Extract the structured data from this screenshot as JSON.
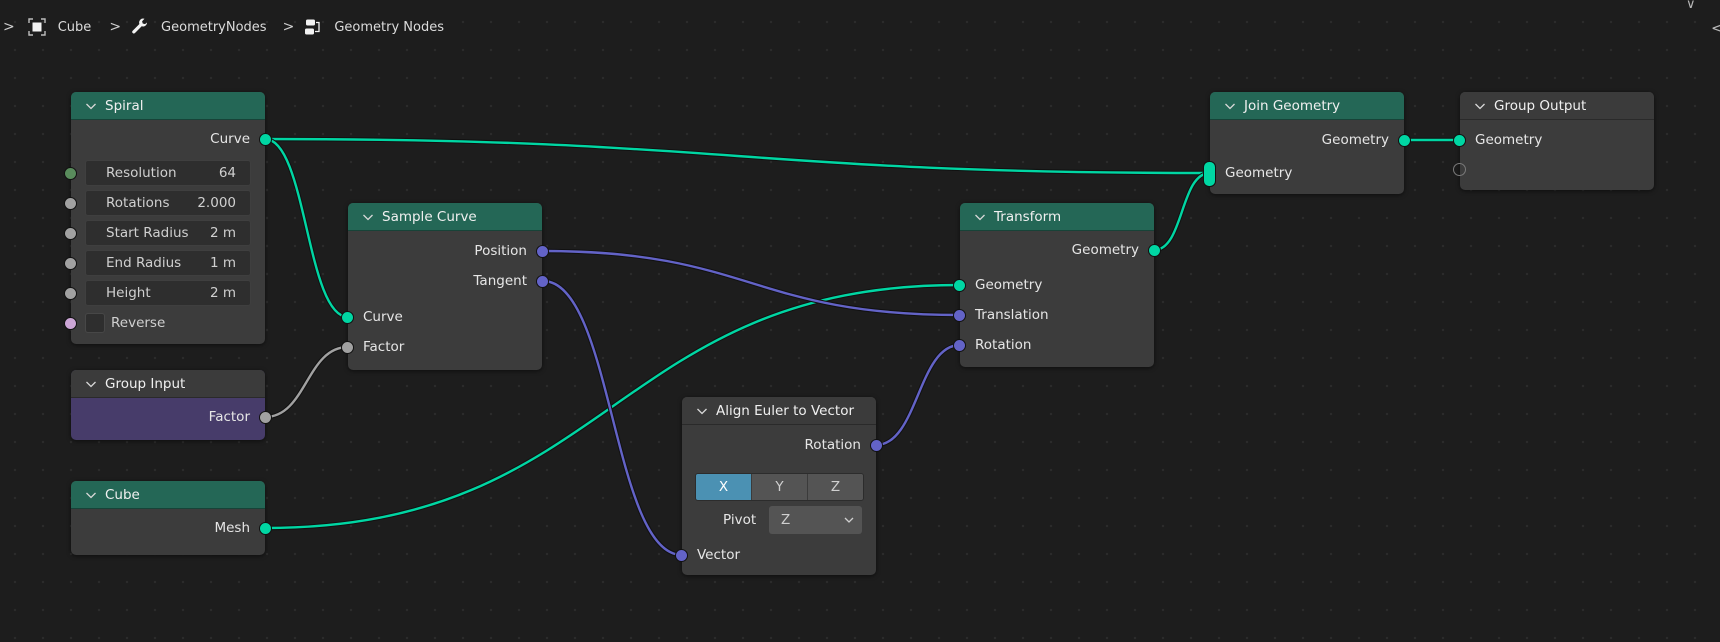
{
  "breadcrumb": {
    "items": [
      {
        "icon": "object-cube-icon",
        "label": "Cube"
      },
      {
        "icon": "wrench-modifier-icon",
        "label": "GeometryNodes"
      },
      {
        "icon": "node-tree-icon",
        "label": "Geometry Nodes"
      }
    ],
    "separator": ">"
  },
  "corner": {
    "collapse_glyph": "∨",
    "sidebar_glyph": "<"
  },
  "colors": {
    "geometry_socket": "#00d6a3",
    "vector_socket": "#6363c7",
    "float_socket": "#a1a1a1",
    "integer_socket": "#598c5c",
    "boolean_socket": "#cca6d6",
    "node_header_geometry": "#246756",
    "group_input_body": "#473c6a",
    "active_toggle": "#4b91b3"
  },
  "nodes": {
    "spiral": {
      "title": "Spiral",
      "outputs": [
        "Curve"
      ],
      "fields": [
        {
          "label": "Resolution",
          "value": "64"
        },
        {
          "label": "Rotations",
          "value": "2.000"
        },
        {
          "label": "Start Radius",
          "value": "2 m"
        },
        {
          "label": "End Radius",
          "value": "1 m"
        },
        {
          "label": "Height",
          "value": "2 m"
        }
      ],
      "reverse": {
        "label": "Reverse",
        "checked": false
      }
    },
    "group_input": {
      "title": "Group Input",
      "outputs": [
        "Factor"
      ]
    },
    "cube": {
      "title": "Cube",
      "outputs": [
        "Mesh"
      ]
    },
    "sample_curve": {
      "title": "Sample Curve",
      "outputs": [
        "Position",
        "Tangent"
      ],
      "inputs": [
        "Curve",
        "Factor"
      ]
    },
    "align_euler": {
      "title": "Align Euler to Vector",
      "outputs": [
        "Rotation"
      ],
      "axis_options": [
        "X",
        "Y",
        "Z"
      ],
      "axis_selected": "X",
      "pivot_label": "Pivot",
      "pivot_value": "Z",
      "inputs": [
        "Vector"
      ]
    },
    "transform": {
      "title": "Transform",
      "outputs": [
        "Geometry"
      ],
      "inputs": [
        "Geometry",
        "Translation",
        "Rotation"
      ]
    },
    "join_geometry": {
      "title": "Join Geometry",
      "outputs": [
        "Geometry"
      ],
      "inputs": [
        "Geometry"
      ]
    },
    "group_output": {
      "title": "Group Output",
      "inputs": [
        "Geometry"
      ]
    }
  },
  "links": [
    {
      "from": "spiral.Curve",
      "to": "join_geometry.Geometry",
      "type": "geometry"
    },
    {
      "from": "spiral.Curve",
      "to": "sample_curve.Curve",
      "type": "geometry"
    },
    {
      "from": "group_input.Factor",
      "to": "sample_curve.Factor",
      "type": "float"
    },
    {
      "from": "cube.Mesh",
      "to": "transform.Geometry",
      "type": "geometry"
    },
    {
      "from": "sample_curve.Position",
      "to": "transform.Translation",
      "type": "vector"
    },
    {
      "from": "sample_curve.Tangent",
      "to": "align_euler.Vector",
      "type": "vector"
    },
    {
      "from": "align_euler.Rotation",
      "to": "transform.Rotation",
      "type": "vector"
    },
    {
      "from": "transform.Geometry",
      "to": "join_geometry.Geometry",
      "type": "geometry"
    },
    {
      "from": "join_geometry.Geometry",
      "to": "group_output.Geometry",
      "type": "geometry"
    }
  ]
}
